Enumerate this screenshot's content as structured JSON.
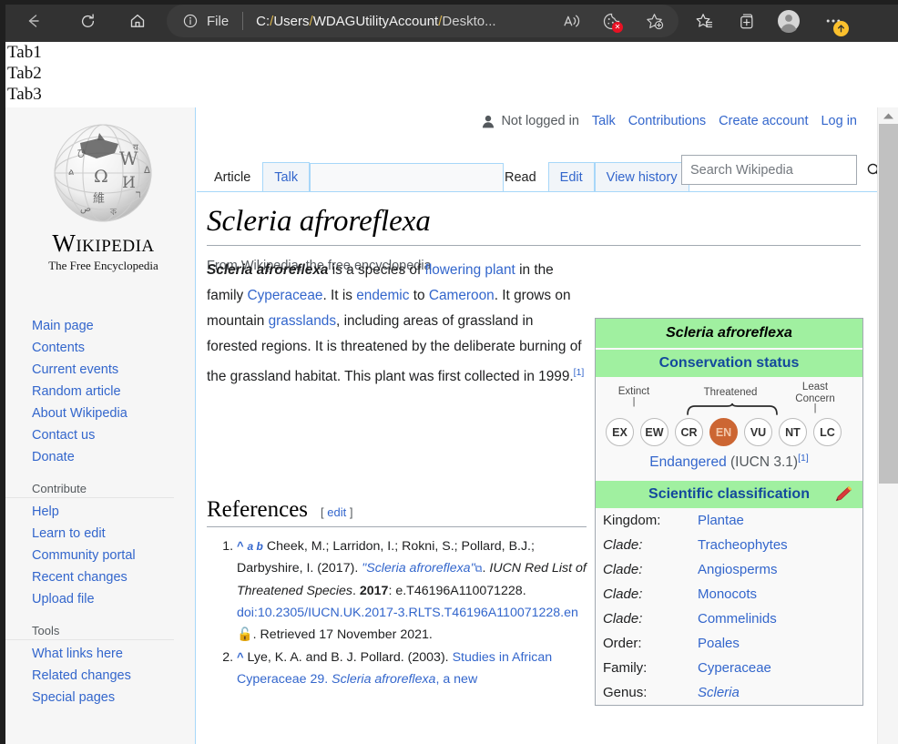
{
  "browser": {
    "nav": {
      "back": "back-arrow-icon",
      "reload": "reload-icon",
      "home": "home-icon"
    },
    "address": {
      "info_icon": "info-circle-icon",
      "file_label": "File",
      "url": "C:/Users/WDAGUtilityAccount/Deskto...",
      "url_segments": [
        "C:",
        "/",
        "Users",
        "/",
        "WDAGUtilityAccount",
        "/",
        "Deskto..."
      ]
    },
    "toolbar_icons": [
      "read-aloud-icon",
      "tracking-prevention-cookie-icon",
      "add-favorite-icon",
      "collections-icon",
      "browser-essentials-icon",
      "profile-icon",
      "settings-and-more-icon"
    ]
  },
  "page_tabs": [
    "Tab1",
    "Tab2",
    "Tab3"
  ],
  "wiki": {
    "logo": {
      "wordmark": "WIKIPEDIA",
      "tagline": "The Free Encyclopedia"
    },
    "sidebar": {
      "groups": [
        {
          "heading": "",
          "items": [
            "Main page",
            "Contents",
            "Current events",
            "Random article",
            "About Wikipedia",
            "Contact us",
            "Donate"
          ]
        },
        {
          "heading": "Contribute",
          "items": [
            "Help",
            "Learn to edit",
            "Community portal",
            "Recent changes",
            "Upload file"
          ]
        },
        {
          "heading": "Tools",
          "items": [
            "What links here",
            "Related changes",
            "Special pages"
          ]
        }
      ]
    },
    "user_links": {
      "status": "Not logged in",
      "links": [
        "Talk",
        "Contributions",
        "Create account",
        "Log in"
      ]
    },
    "namespace_tabs": [
      {
        "label": "Article",
        "active": true
      },
      {
        "label": "Talk",
        "active": false
      }
    ],
    "view_tabs": [
      {
        "label": "Read",
        "active": true
      },
      {
        "label": "Edit",
        "active": false
      },
      {
        "label": "View history",
        "active": false
      }
    ],
    "search": {
      "placeholder": "Search Wikipedia",
      "value": "",
      "icon": "search-icon"
    },
    "article": {
      "title": "Scleria afroreflexa",
      "subtitle": "From Wikipedia, the free encyclopedia",
      "lead": {
        "bold_name": "Scleria afroreflexa",
        "t1": " is a species of ",
        "l1": "flowering plant",
        "t2": " in the family ",
        "l2": "Cyperaceae",
        "t3": ". It is ",
        "l3": "endemic",
        "t4": " to ",
        "l4": "Cameroon",
        "t5": ". It grows on mountain ",
        "l5": "grasslands",
        "t6": ", including areas of grassland in forested regions. It is threatened by the deliberate burning of the grassland habitat. This plant was first collected in 1999.",
        "ref": "[1]"
      }
    },
    "references": {
      "heading": "References",
      "edit_open": "[",
      "edit_label": "edit",
      "edit_close": "]",
      "items": [
        {
          "backlink": "^",
          "ab": "a b",
          "p1": " Cheek, M.; Larridon, I.; Rokni, S.; Pollard, B.J.; Darbyshire, I. (2017). ",
          "link_title": "\"Scleria afroreflexa\"",
          "ext": "⧉",
          "p2": ". ",
          "journal": "IUCN Red List of Threatened Species",
          "p3": ". ",
          "volume": "2017",
          "p4": ": e.T46196A110071228. ",
          "doi": "doi:10.2305/IUCN.UK.2017-3.RLTS.T46196A110071228.en",
          "oa": "open-access-lock-icon",
          "p5": ". Retrieved 17 November 2021."
        },
        {
          "backlink": "^",
          "p1": " Lye, K. A. and B. J. Pollard. (2003). ",
          "link_a": "Studies in African Cyperaceae 29. ",
          "link_b_italic": "Scleria afroreflexa",
          "link_c": ", a new"
        }
      ]
    },
    "infobox": {
      "title": "Scleria afroreflexa",
      "conservation_heading": "Conservation status",
      "status_labels": {
        "extinct": "Extinct",
        "threatened": "Threatened",
        "least_concern_line1": "Least",
        "least_concern_line2": "Concern"
      },
      "status_circles": [
        {
          "code": "EX",
          "selected": false
        },
        {
          "code": "EW",
          "selected": false
        },
        {
          "code": "CR",
          "selected": false
        },
        {
          "code": "EN",
          "selected": true
        },
        {
          "code": "VU",
          "selected": false
        },
        {
          "code": "NT",
          "selected": false
        },
        {
          "code": "LC",
          "selected": false
        }
      ],
      "status_caption": "Endangered",
      "status_caption_detail": " (IUCN 3.1)",
      "status_caption_ref": "[1]",
      "sci_classification_heading": "Scientific classification",
      "edit_pencil": "pencil-edit-icon",
      "taxonomy": [
        {
          "rank": "Kingdom:",
          "italic_rank": false,
          "value": "Plantae",
          "italic_value": false
        },
        {
          "rank": "Clade:",
          "italic_rank": true,
          "value": "Tracheophytes",
          "italic_value": false
        },
        {
          "rank": "Clade:",
          "italic_rank": true,
          "value": "Angiosperms",
          "italic_value": false
        },
        {
          "rank": "Clade:",
          "italic_rank": true,
          "value": "Monocots",
          "italic_value": false
        },
        {
          "rank": "Clade:",
          "italic_rank": true,
          "value": "Commelinids",
          "italic_value": false
        },
        {
          "rank": "Order:",
          "italic_rank": false,
          "value": "Poales",
          "italic_value": false
        },
        {
          "rank": "Family:",
          "italic_rank": false,
          "value": "Cyperaceae",
          "italic_value": false
        },
        {
          "rank": "Genus:",
          "italic_rank": false,
          "value": "Scleria",
          "italic_value": true
        }
      ]
    }
  },
  "colors": {
    "chrome_bg": "#323232",
    "wiki_link": "#3366cc",
    "taxobox_green": "#a0f0a0",
    "endangered_orange": "#cc6633",
    "tab_border_blue": "#a7d7f9"
  }
}
